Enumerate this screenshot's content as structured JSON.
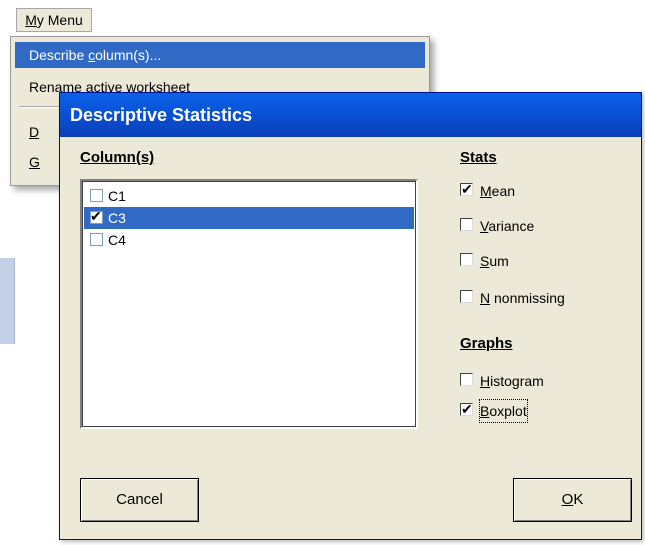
{
  "menubar": {
    "menu_first": "M",
    "menu_rest": "y Menu"
  },
  "dropdown": {
    "items": [
      {
        "pre": "Describe ",
        "ul": "c",
        "post": "olumn(s)..."
      },
      {
        "pre": "Rename active worksheet",
        "ul": "",
        "post": ""
      },
      {
        "pre": "",
        "ul": "D",
        "post": ""
      },
      {
        "pre": "",
        "ul": "G",
        "post": ""
      }
    ]
  },
  "dialog": {
    "title": "Descriptive Statistics",
    "columns_label": "Column(s)",
    "columns": [
      {
        "name": "C1",
        "checked": false,
        "selected": false
      },
      {
        "name": "C3",
        "checked": true,
        "selected": true
      },
      {
        "name": "C4",
        "checked": false,
        "selected": false
      }
    ],
    "stats_label": "Stats",
    "stats": [
      {
        "ul": "M",
        "rest": "ean",
        "checked": true
      },
      {
        "ul": "V",
        "rest": "ariance",
        "checked": false
      },
      {
        "ul": "S",
        "rest": "um",
        "checked": false
      },
      {
        "ul": "N",
        "rest": " nonmissing",
        "checked": false
      }
    ],
    "graphs_label": "Graphs",
    "graphs": [
      {
        "ul": "H",
        "rest": "istogram",
        "checked": false
      },
      {
        "ul": "B",
        "rest": "oxplot",
        "checked": true
      }
    ],
    "cancel_label": "Cancel",
    "ok_ul": "O",
    "ok_rest": "K",
    "check_glyph": "✔"
  },
  "colors": {
    "title_bar": "#0a4ed0",
    "selection": "#316ac5",
    "dialog_bg": "#ece9d8"
  }
}
